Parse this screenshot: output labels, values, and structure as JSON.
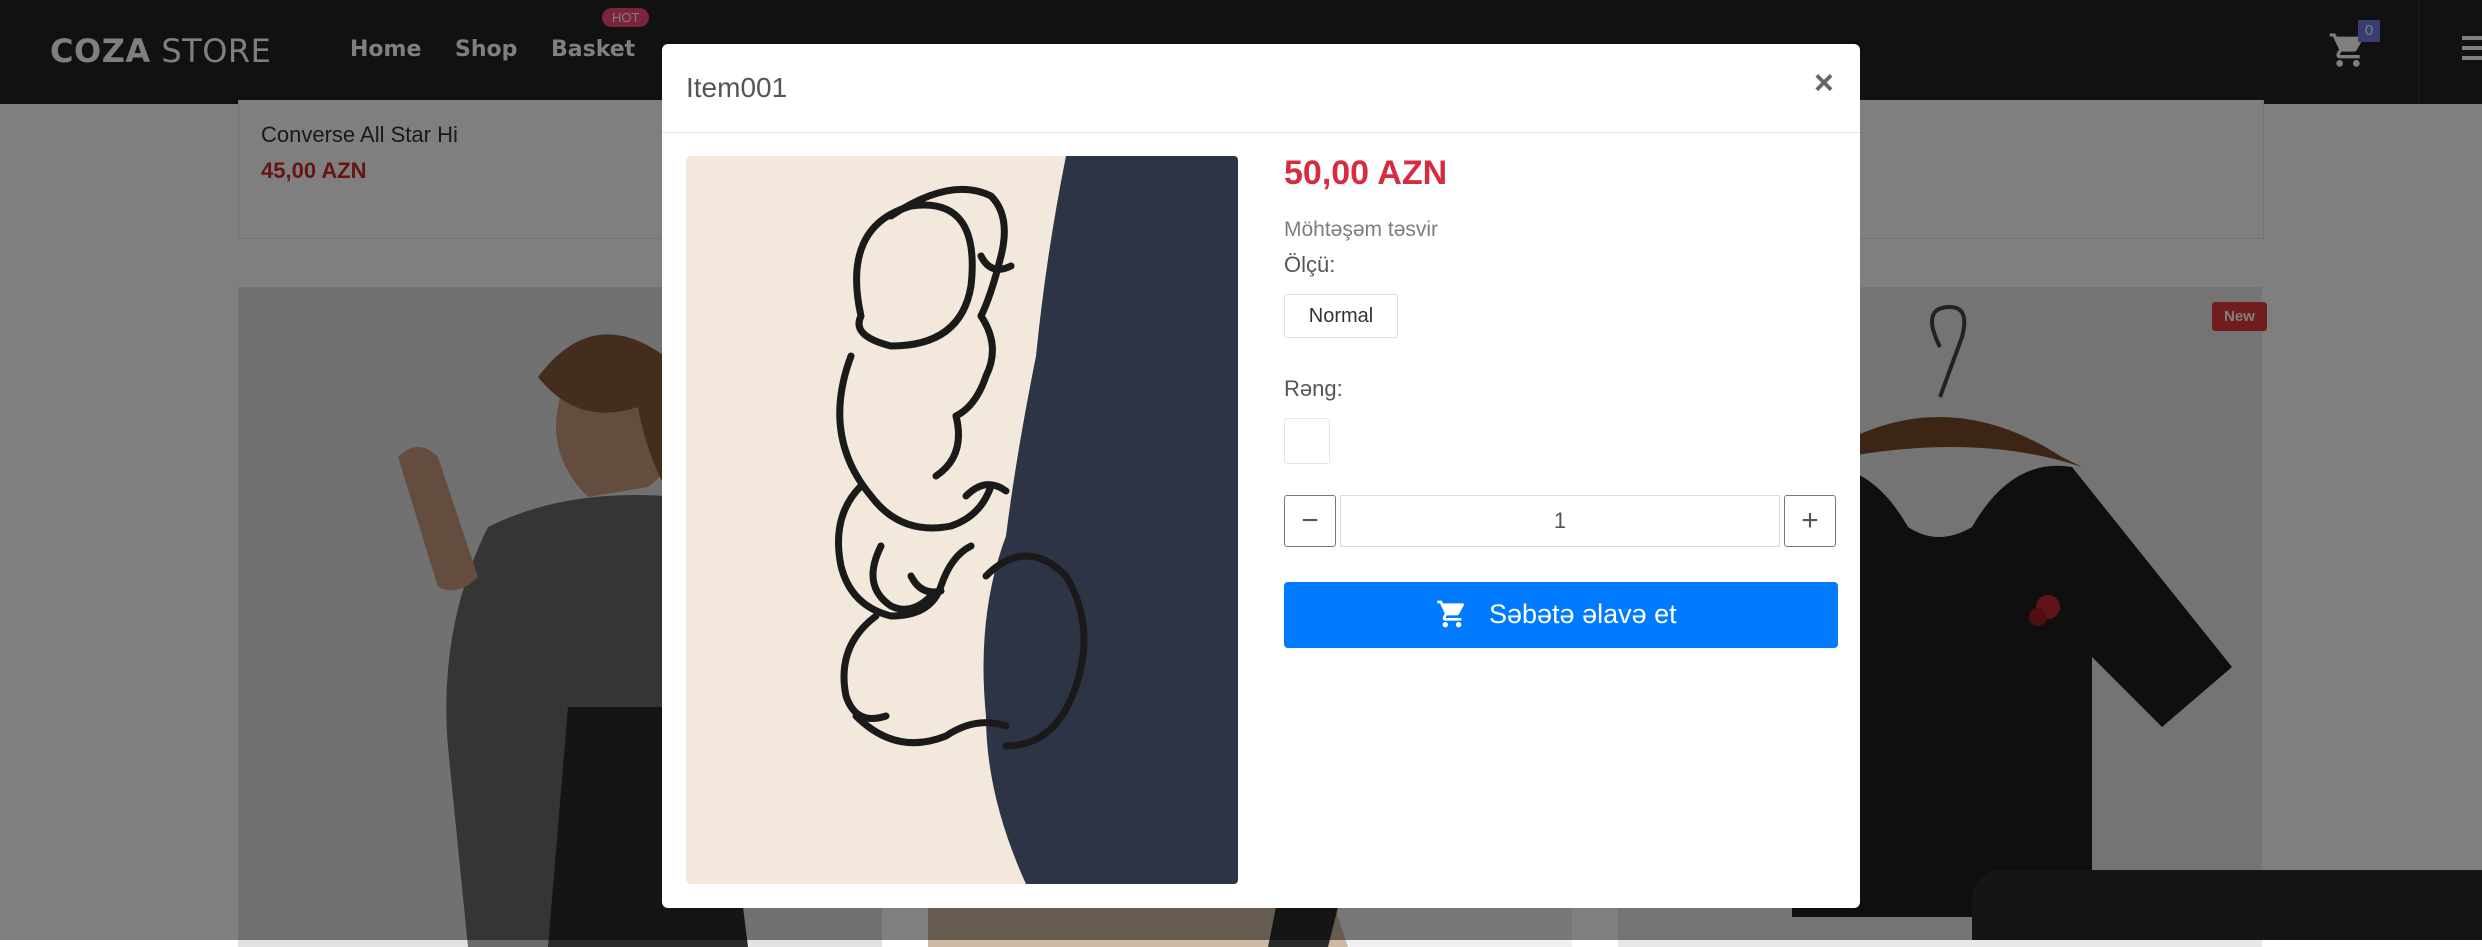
{
  "header": {
    "logo_bold": "COZA",
    "logo_light": "STORE",
    "nav": [
      "Home",
      "Shop",
      "Basket"
    ],
    "hot_badge": "HOT",
    "cart_count": "0"
  },
  "background": {
    "top_product_name": "Converse All Star Hi",
    "top_product_price": "45,00 AZN",
    "new_badge": "New"
  },
  "modal": {
    "title": "Item001",
    "close_symbol": "×",
    "price": "50,00 AZN",
    "description": "Möhtəşəm təsvir",
    "size_label": "Ölçü:",
    "size_option": "Normal",
    "color_label": "Rəng:",
    "quantity": "1",
    "minus_symbol": "−",
    "plus_symbol": "+",
    "add_to_cart": "Səbətə əlavə et"
  },
  "colors": {
    "header_bg": "#222222",
    "price_red": "#d72b3f",
    "primary_button": "#007bff",
    "hot_badge": "#f74877",
    "new_badge": "#e23b3b",
    "cart_badge": "#717fe0"
  },
  "icons": [
    "cart-icon",
    "menu-icon",
    "close-icon",
    "minus-icon",
    "plus-icon"
  ]
}
